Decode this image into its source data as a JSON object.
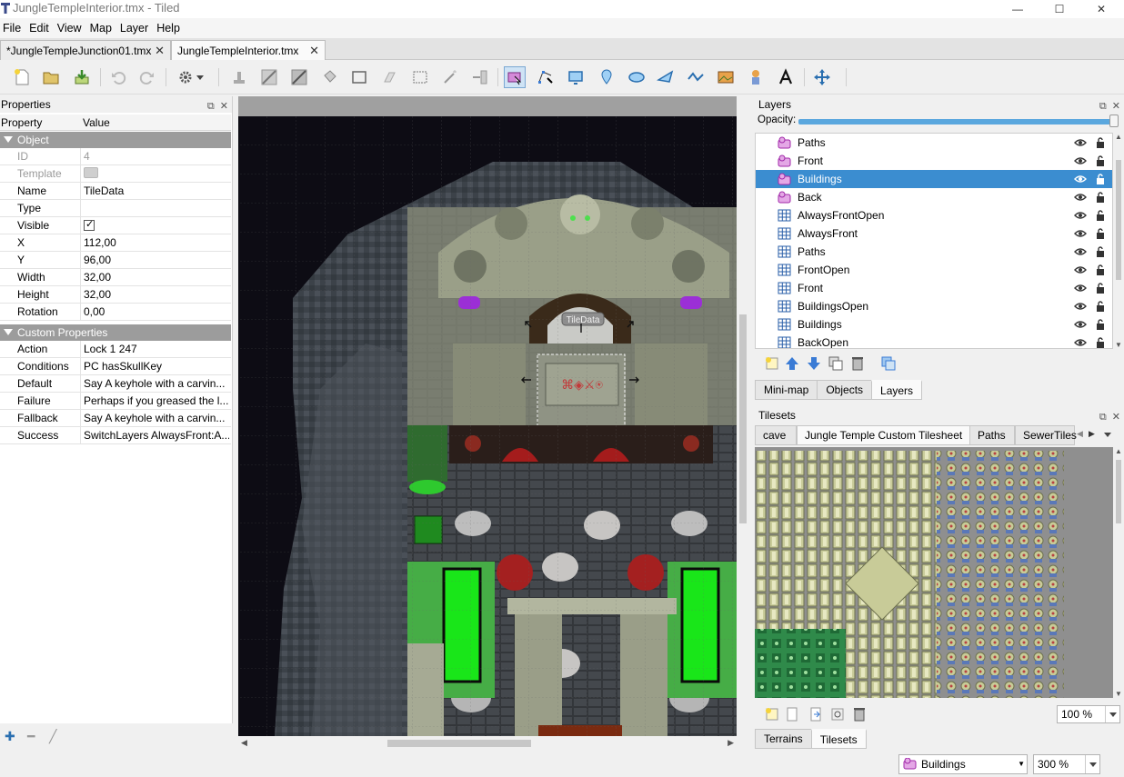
{
  "window": {
    "title": "JungleTempleInterior.tmx - Tiled",
    "minimize": "—",
    "maximize": "☐",
    "close": "✕"
  },
  "menu": [
    "File",
    "Edit",
    "View",
    "Map",
    "Layer",
    "Help"
  ],
  "doc_tabs": [
    {
      "label": "*JungleTempleJunction01.tmx",
      "active": false
    },
    {
      "label": "JungleTempleInterior.tmx",
      "active": true
    }
  ],
  "properties": {
    "panel_title": "Properties",
    "col_property": "Property",
    "col_value": "Value",
    "group_object": "Object",
    "rows": [
      {
        "key": "ID",
        "value": "4",
        "grey": true
      },
      {
        "key": "Template",
        "value": "",
        "grey": true,
        "swatch": true
      },
      {
        "key": "Name",
        "value": "TileData"
      },
      {
        "key": "Type",
        "value": ""
      },
      {
        "key": "Visible",
        "value": "",
        "checkbox": true
      },
      {
        "key": "X",
        "value": "112,00"
      },
      {
        "key": "Y",
        "value": "96,00"
      },
      {
        "key": "Width",
        "value": "32,00"
      },
      {
        "key": "Height",
        "value": "32,00"
      },
      {
        "key": "Rotation",
        "value": "0,00"
      }
    ],
    "group_custom": "Custom Properties",
    "custom_rows": [
      {
        "key": "Action",
        "value": "Lock 1 247"
      },
      {
        "key": "Conditions",
        "value": "PC hasSkullKey"
      },
      {
        "key": "Default",
        "value": "Say A keyhole with a carvin..."
      },
      {
        "key": "Failure",
        "value": "Perhaps if you greased the l..."
      },
      {
        "key": "Fallback",
        "value": "Say A keyhole with a carvin..."
      },
      {
        "key": "Success",
        "value": "SwitchLayers AlwaysFront:A..."
      }
    ]
  },
  "map": {
    "object_label": "TileData",
    "selected_object": "TileData"
  },
  "layers": {
    "panel_title": "Layers",
    "opacity_label": "Opacity:",
    "opacity_value": 1.0,
    "items": [
      {
        "name": "Paths",
        "kind": "object"
      },
      {
        "name": "Front",
        "kind": "object"
      },
      {
        "name": "Buildings",
        "kind": "object",
        "selected": true
      },
      {
        "name": "Back",
        "kind": "object"
      },
      {
        "name": "AlwaysFrontOpen",
        "kind": "tile"
      },
      {
        "name": "AlwaysFront",
        "kind": "tile"
      },
      {
        "name": "Paths",
        "kind": "tile"
      },
      {
        "name": "FrontOpen",
        "kind": "tile"
      },
      {
        "name": "Front",
        "kind": "tile"
      },
      {
        "name": "BuildingsOpen",
        "kind": "tile"
      },
      {
        "name": "Buildings",
        "kind": "tile"
      },
      {
        "name": "BackOpen",
        "kind": "tile"
      }
    ],
    "tabs": [
      {
        "label": "Mini-map",
        "active": false
      },
      {
        "label": "Objects",
        "active": false
      },
      {
        "label": "Layers",
        "active": true
      }
    ]
  },
  "tilesets": {
    "panel_title": "Tilesets",
    "tabs": [
      {
        "label": "cave",
        "active": false
      },
      {
        "label": "Jungle Temple Custom Tilesheet",
        "active": true
      },
      {
        "label": "Paths",
        "active": false
      },
      {
        "label": "SewerTiles",
        "active": false
      }
    ],
    "zoom": "100 %",
    "bottom_tabs": [
      {
        "label": "Terrains",
        "active": false
      },
      {
        "label": "Tilesets",
        "active": true
      }
    ]
  },
  "status": {
    "current_layer": "Buildings",
    "zoom": "300 %"
  },
  "colors": {
    "selection": "#3b8dd0",
    "accent": "#5aa7de",
    "group_header": "#9c9c9c",
    "object_layer_icon": "#c040c0"
  }
}
